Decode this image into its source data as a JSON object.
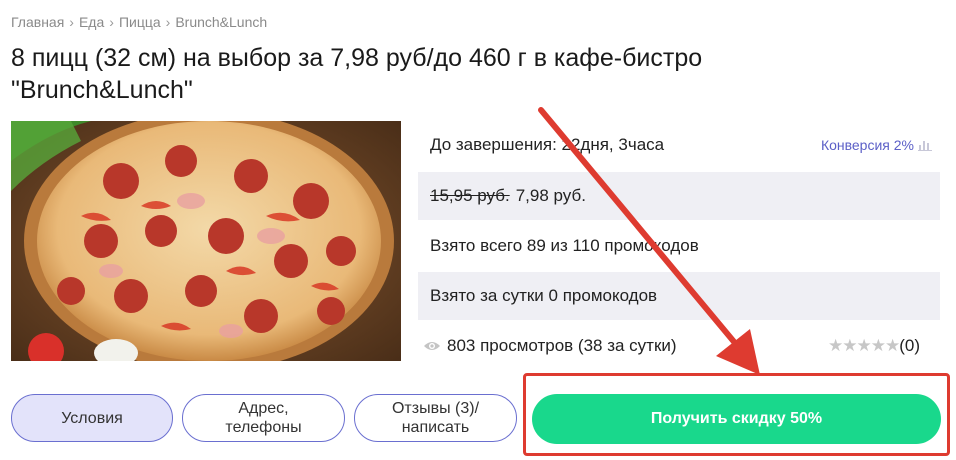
{
  "breadcrumb": [
    "Главная",
    "Еда",
    "Пицца",
    "Brunch&Lunch"
  ],
  "title": "8 пицц (32 см) на выбор за 7,98 руб/до 460 г в кафе-бистро \"Brunch&Lunch\"",
  "image": {
    "icon": "pizza-photo"
  },
  "info": {
    "ends_text": "До завершения: 22дня, 3часа",
    "conversion": "Конверсия 2%",
    "old_price": "15,95 руб.",
    "new_price": "7,98 руб.",
    "taken_total": "Взято всего 89 из 110 промокодов",
    "taken_day": "Взято за сутки 0 промокодов",
    "views": "803 просмотров (38 за сутки)",
    "stars": "★★★★★",
    "rating_count": "(0)"
  },
  "buttons": {
    "conditions": "Условия",
    "address_line1": "Адрес,",
    "address_line2": "телефоны",
    "reviews_line1": "Отзывы (3)/",
    "reviews_line2": "написать",
    "discount": "Получить скидку 50%"
  },
  "colors": {
    "accent": "#19d88c",
    "purple": "#5b5fc7",
    "annotation": "#de3b30",
    "row_bg": "#efeff4"
  }
}
